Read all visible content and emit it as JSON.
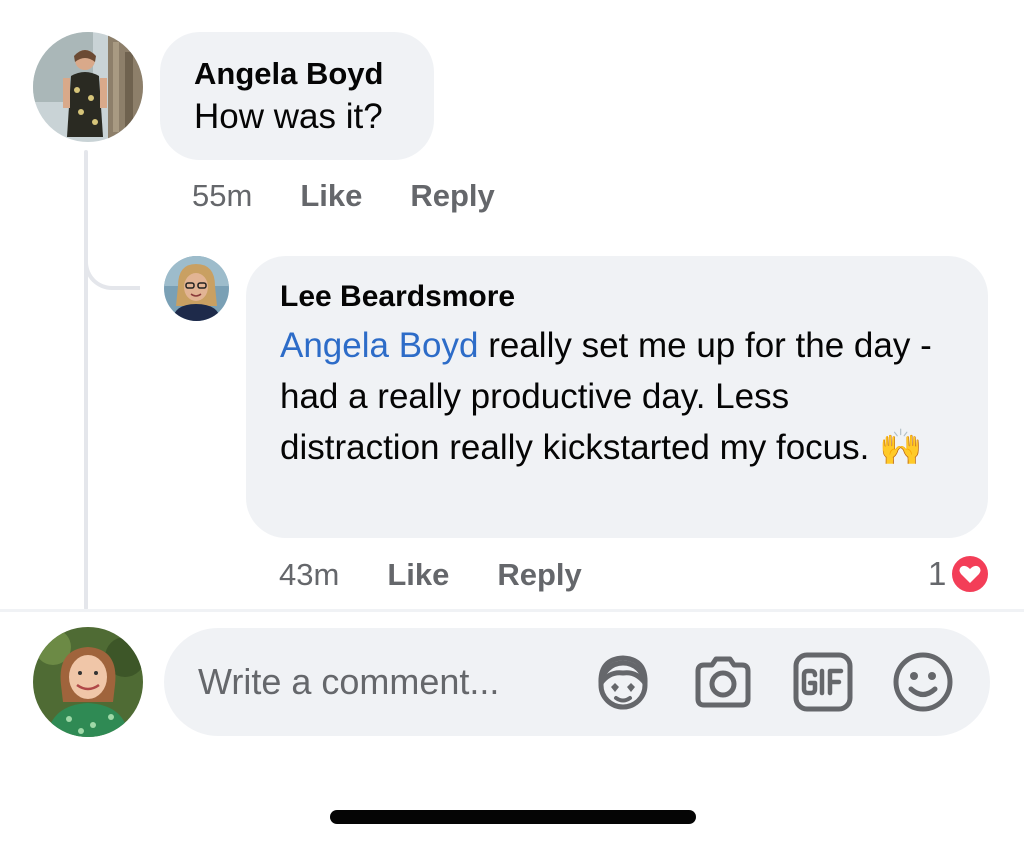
{
  "comments": [
    {
      "author": "Angela Boyd",
      "text": "How was it?",
      "time": "55m",
      "like_label": "Like",
      "reply_label": "Reply"
    }
  ],
  "replies": [
    {
      "author": "Lee Beardsmore",
      "mention": "Angela Boyd",
      "text": " really set me up for the day - had a really productive day. Less distraction really kickstarted my focus. 🙌",
      "time": "43m",
      "like_label": "Like",
      "reply_label": "Reply",
      "reaction_count": "1",
      "reaction_type": "love-icon"
    }
  ],
  "composer": {
    "placeholder": "Write a comment...",
    "icons": [
      "avatar-sticker-icon",
      "camera-icon",
      "gif-icon",
      "emoji-icon"
    ]
  },
  "colors": {
    "bubble": "#f0f2f5",
    "mention": "#2d6cc8",
    "meta": "#65676b",
    "love": "#f33e58"
  }
}
